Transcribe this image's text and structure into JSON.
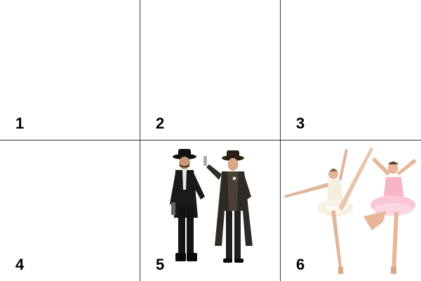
{
  "grid": {
    "cells": [
      {
        "number": "1",
        "image": "empty"
      },
      {
        "number": "2",
        "image": "empty"
      },
      {
        "number": "3",
        "image": "empty"
      },
      {
        "number": "4",
        "image": "empty"
      },
      {
        "number": "5",
        "image": "two-cowboys-in-western-costumes"
      },
      {
        "number": "6",
        "image": "two-ballerinas-dancing"
      }
    ]
  }
}
